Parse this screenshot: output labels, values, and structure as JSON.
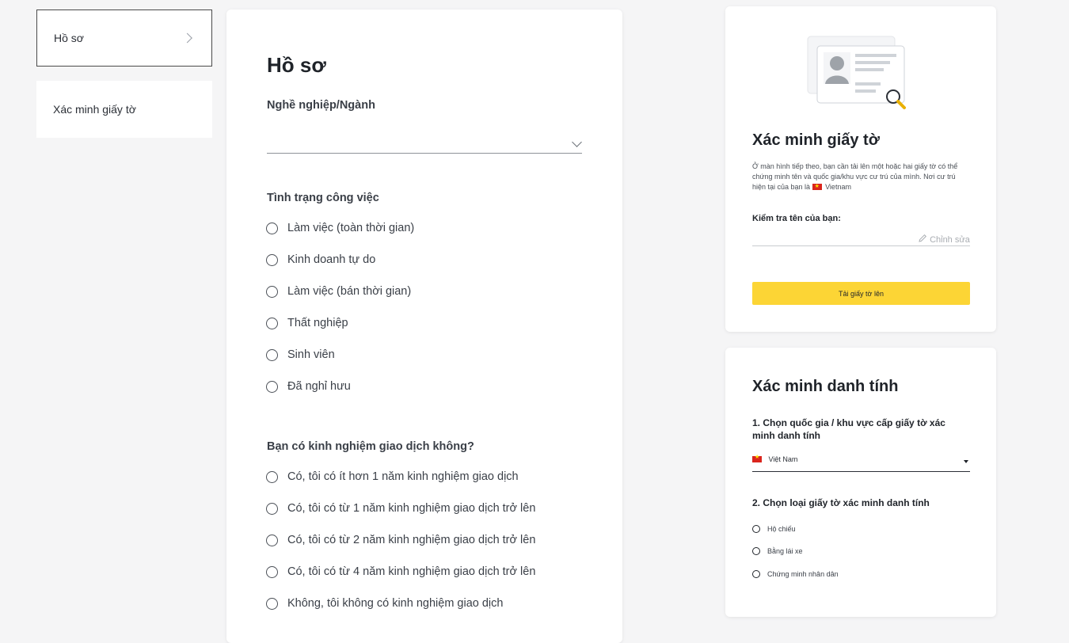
{
  "sidebar": {
    "items": [
      {
        "label": "Hồ sơ",
        "active": true
      },
      {
        "label": "Xác minh giấy tờ",
        "active": false
      }
    ]
  },
  "profile_form": {
    "title": "Hồ sơ",
    "occupation": {
      "label": "Nghề nghiệp/Ngành",
      "value": ""
    },
    "employment_status": {
      "label": "Tình trạng công việc",
      "options": [
        "Làm việc (toàn thời gian)",
        "Kinh doanh tự do",
        "Làm việc (bán thời gian)",
        "Thất nghiệp",
        "Sinh viên",
        "Đã nghỉ hưu"
      ]
    },
    "trading_experience": {
      "label": "Bạn có kinh nghiệm giao dịch không?",
      "options": [
        "Có, tôi có ít hơn 1 năm kinh nghiệm giao dịch",
        "Có, tôi có từ 1 năm kinh nghiệm giao dịch trở lên",
        "Có, tôi có từ 2 năm kinh nghiệm giao dịch trở lên",
        "Có, tôi có từ 4 năm kinh nghiệm giao dịch trở lên",
        "Không, tôi không có kinh nghiệm giao dịch"
      ]
    }
  },
  "doc_verification": {
    "title": "Xác minh giấy tờ",
    "description": "Ở màn hình tiếp theo, bạn cần tải lên một hoặc hai giấy tờ có thể chứng minh tên và quốc gia/khu vực cư trú của mình. Nơi cư trú hiện tại của bạn là",
    "residence_country": "Vietnam",
    "name_check_label": "Kiểm tra tên của bạn:",
    "name_value": "",
    "edit_label": "Chỉnh sửa",
    "upload_button": "Tải giấy tờ lên"
  },
  "identity_verification": {
    "title": "Xác minh danh tính",
    "step1_label": "1. Chọn quốc gia / khu vực cấp giấy tờ xác minh danh tính",
    "country_selected": "Việt Nam",
    "step2_label": "2. Chọn loại giấy tờ xác minh danh tính",
    "doc_types": [
      "Hộ chiếu",
      "Bằng lái xe",
      "Chứng minh nhân dân"
    ]
  },
  "colors": {
    "accent": "#fcd535",
    "background": "#f5f5f6",
    "flag_red": "#da251d",
    "flag_star": "#ffe000"
  }
}
